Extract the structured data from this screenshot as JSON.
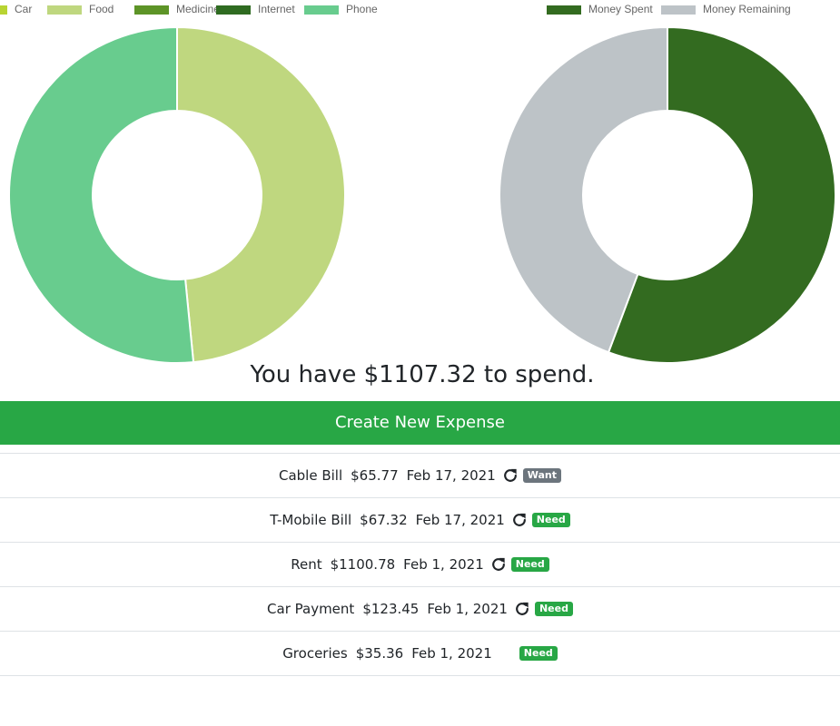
{
  "chart_data": [
    {
      "type": "pie",
      "legend": [
        "Car",
        "Food",
        "Medicine",
        "Internet",
        "Phone"
      ],
      "colors": [
        "#b8d432",
        "#bfd77f",
        "#5d9427",
        "#2f6b21",
        "#68cc8e"
      ],
      "values": [
        0,
        33.23,
        0,
        0,
        35.36
      ],
      "legend_position": "top"
    },
    {
      "type": "pie",
      "legend": [
        "Money Spent",
        "Money Remaining"
      ],
      "colors": [
        "#336b20",
        "#bdc3c7"
      ],
      "values": [
        1392.68,
        1107.32
      ],
      "legend_position": "top"
    }
  ],
  "summary": "You have $1107.32 to spend.",
  "create_button": "Create New Expense",
  "expenses": [
    {
      "name": "Cable Bill",
      "amount": "$65.77",
      "date": "Feb 17, 2021",
      "recurring": true,
      "tag": "Want"
    },
    {
      "name": "T-Mobile Bill",
      "amount": "$67.32",
      "date": "Feb 17, 2021",
      "recurring": true,
      "tag": "Need"
    },
    {
      "name": "Rent",
      "amount": "$1100.78",
      "date": "Feb 1, 2021",
      "recurring": true,
      "tag": "Need"
    },
    {
      "name": "Car Payment",
      "amount": "$123.45",
      "date": "Feb 1, 2021",
      "recurring": true,
      "tag": "Need"
    },
    {
      "name": "Groceries",
      "amount": "$35.36",
      "date": "Feb 1, 2021",
      "recurring": false,
      "tag": "Need"
    }
  ],
  "icons": {
    "recurring": "repeat-icon"
  }
}
